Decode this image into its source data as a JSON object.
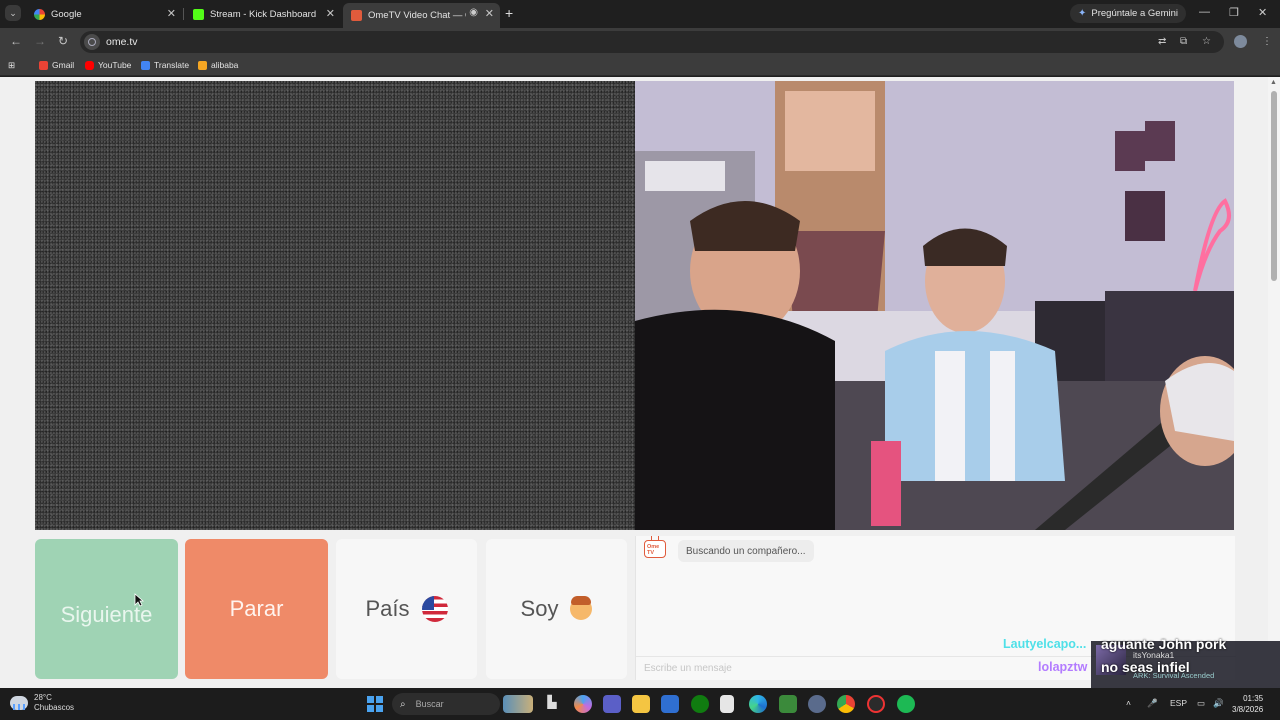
{
  "browser": {
    "tabs": [
      {
        "title": "Google",
        "active": false
      },
      {
        "title": "Stream - Kick Dashboard",
        "active": false
      },
      {
        "title": "OmeTV Video Chat — Ome",
        "active": true
      }
    ],
    "gemini_label": "Pregúntale a Gemini",
    "url": "ome.tv",
    "bookmarks": [
      {
        "label": "Gmail",
        "color": "#ea4335"
      },
      {
        "label": "YouTube",
        "color": "#ff0000"
      },
      {
        "label": "Translate",
        "color": "#4285f4"
      },
      {
        "label": "alibaba",
        "color": "#f5a623"
      }
    ]
  },
  "page": {
    "buttons": {
      "next": "Siguiente",
      "stop": "Parar",
      "country": "País",
      "gender": "Soy"
    },
    "chat": {
      "status_message": "Buscando un compañero...",
      "input_placeholder": "Escribe un mensaje",
      "logo_text": "Ome TV"
    },
    "colors": {
      "next_button": "#9fd3b4",
      "stop_button": "#ef8a68"
    }
  },
  "stream_overlay": {
    "messages": [
      {
        "user": "Lautyelcapo...",
        "text": "aguante John pork",
        "user_color": "#4fe0e8"
      },
      {
        "user": "lolapztw",
        "text": "no seas infiel",
        "user_color": "#b37cff"
      }
    ],
    "card_user": "itsYonaka1",
    "card_game": "ARK: Survival Ascended"
  },
  "taskbar": {
    "weather_temp": "28°C",
    "weather_desc": "Chubascos",
    "search_placeholder": "Buscar",
    "language": "ESP",
    "time": "01:35",
    "date": "3/8/2026"
  }
}
